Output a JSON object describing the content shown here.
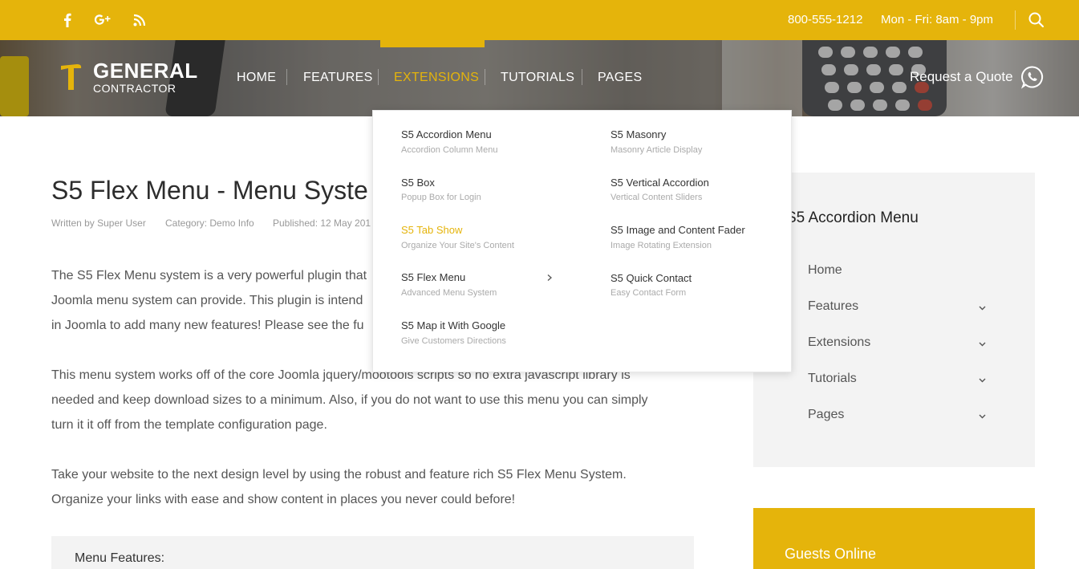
{
  "topbar": {
    "social": [
      {
        "name": "facebook-icon",
        "glyph": "f"
      },
      {
        "name": "google-plus-icon",
        "glyph": "g+"
      },
      {
        "name": "rss-icon",
        "glyph": "rss"
      }
    ],
    "phone": "800-555-1212",
    "hours": "Mon - Fri: 8am - 9pm",
    "search_icon": "search-icon"
  },
  "header": {
    "logo_title": "GENERAL",
    "logo_subtitle": "CONTRACTOR",
    "nav": [
      {
        "label": "HOME",
        "active": false
      },
      {
        "label": "FEATURES",
        "active": false
      },
      {
        "label": "EXTENSIONS",
        "active": true
      },
      {
        "label": "TUTORIALS",
        "active": false
      },
      {
        "label": "PAGES",
        "active": false
      }
    ],
    "quote_label": "Request a Quote",
    "quote_icon": "whatsapp-icon"
  },
  "dropdown": {
    "left": [
      {
        "title": "S5 Accordion Menu",
        "subtitle": "Accordion Column Menu",
        "active": false
      },
      {
        "title": "S5 Box",
        "subtitle": "Popup Box for Login",
        "active": false
      },
      {
        "title": "S5 Tab Show",
        "subtitle": "Organize Your Site's Content",
        "active": true
      },
      {
        "title": "S5 Flex Menu",
        "subtitle": "Advanced Menu System",
        "active": false,
        "has_submenu": true
      },
      {
        "title": "S5 Map it With Google",
        "subtitle": "Give Customers Directions",
        "active": false
      }
    ],
    "right": [
      {
        "title": "S5 Masonry",
        "subtitle": "Masonry Article Display"
      },
      {
        "title": "S5 Vertical Accordion",
        "subtitle": "Vertical Content Sliders"
      },
      {
        "title": "S5 Image and Content Fader",
        "subtitle": "Image Rotating Extension"
      },
      {
        "title": "S5 Quick Contact",
        "subtitle": "Easy Contact Form"
      }
    ]
  },
  "article": {
    "title": "S5 Flex Menu - Menu Syste",
    "meta": {
      "author": "Written by Super User",
      "category": "Category: Demo Info",
      "published": "Published: 12 May 201"
    },
    "para1": [
      "The S5 Flex Menu system is a very powerful plugin that",
      "Joomla menu system can provide. This plugin is intend",
      "in Joomla to add many new features! Please see the fu"
    ],
    "para2": [
      "This menu system works off of the core Joomla jquery/mootools scripts so no extra javascript library is",
      "needed and keep download sizes to a minimum. Also, if you do not want to use this menu you can simply",
      "turn it it off from the template configuration page."
    ],
    "para3": [
      "Take your website to the next design level by using the robust and feature rich S5 Flex Menu System.",
      "Organize your links with ease and show content in places you never could before!"
    ],
    "features_title": "Menu Features:"
  },
  "sidebar": {
    "title": "S5 Accordion Menu",
    "items": [
      {
        "label": "Home",
        "expandable": false
      },
      {
        "label": "Features",
        "expandable": true
      },
      {
        "label": "Extensions",
        "expandable": true
      },
      {
        "label": "Tutorials",
        "expandable": true
      },
      {
        "label": "Pages",
        "expandable": true
      }
    ],
    "guests_title": "Guests Online"
  },
  "colors": {
    "accent": "#e5b40b",
    "text": "#333333",
    "muted": "#aaaaaa",
    "panel": "#f3f3f3"
  }
}
